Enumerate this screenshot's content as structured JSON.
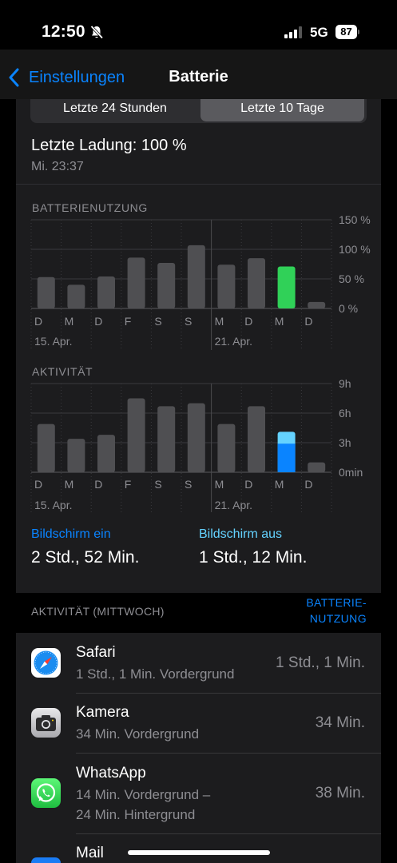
{
  "status": {
    "time": "12:50",
    "network": "5G",
    "battery": "87"
  },
  "nav": {
    "back_label": "Einstellungen",
    "title": "Batterie"
  },
  "segments": [
    "Letzte 24 Stunden",
    "Letzte 10 Tage"
  ],
  "last_charge": {
    "label": "Letzte Ladung: 100 %",
    "time": "Mi. 23:37"
  },
  "chart_data": [
    {
      "type": "bar",
      "title": "BATTERIENUTZUNG",
      "categories": [
        "D",
        "M",
        "D",
        "F",
        "S",
        "S",
        "M",
        "D",
        "M",
        "D"
      ],
      "date_labels": [
        "15. Apr.",
        "21. Apr."
      ],
      "values": [
        53,
        40,
        54,
        86,
        77,
        107,
        74,
        85,
        71,
        11
      ],
      "ylim": [
        0,
        150
      ],
      "ytick_labels": [
        "150 %",
        "100 %",
        "50 %",
        "0 %"
      ],
      "highlight_index": 8,
      "colors": {
        "bar": "#4f4f52",
        "highlight": "#30d158"
      }
    },
    {
      "type": "bar",
      "title": "AKTIVITÄT",
      "categories": [
        "D",
        "M",
        "D",
        "F",
        "S",
        "S",
        "M",
        "D",
        "M",
        "D"
      ],
      "date_labels": [
        "15. Apr.",
        "21. Apr."
      ],
      "series": [
        {
          "name": "Bildschirm ein",
          "values": [
            4.9,
            3.4,
            3.8,
            7.5,
            6.7,
            7.0,
            4.9,
            6.7,
            2.9,
            1.0
          ]
        },
        {
          "name": "Bildschirm aus",
          "values": [
            0,
            0,
            0,
            0,
            0,
            0,
            0,
            0,
            1.2,
            0
          ]
        }
      ],
      "ylim": [
        0,
        9
      ],
      "ytick_labels": [
        "9h",
        "6h",
        "3h",
        "0min"
      ],
      "highlight_index": 8,
      "colors": {
        "bar": "#4f4f52",
        "screen_on": "#0a84ff",
        "screen_off": "#64d2ff"
      }
    }
  ],
  "screen": {
    "on_label": "Bildschirm ein",
    "on_value": "2 Std., 52 Min.",
    "off_label": "Bildschirm aus",
    "off_value": "1 Std., 12 Min."
  },
  "list": {
    "header": "AKTIVITÄT (MITTWOCH)",
    "link_line1": "BATTERIE-",
    "link_line2": "NUTZUNG",
    "apps": [
      {
        "name": "Safari",
        "sub1": "1 Std., 1 Min. Vordergrund",
        "sub2": "",
        "value": "1 Std., 1 Min.",
        "icon": "safari-icon"
      },
      {
        "name": "Kamera",
        "sub1": "34 Min. Vordergrund",
        "sub2": "",
        "value": "34 Min.",
        "icon": "camera-icon"
      },
      {
        "name": "WhatsApp",
        "sub1": "14 Min. Vordergrund –",
        "sub2": "24 Min. Hintergrund",
        "value": "38 Min.",
        "icon": "whatsapp-icon"
      },
      {
        "name": "Mail",
        "sub1": "",
        "sub2": "",
        "value": "",
        "icon": "mail-icon"
      }
    ]
  },
  "colors": {
    "accent": "#0a84ff",
    "accent_light": "#64d2ff",
    "green": "#30d158"
  }
}
